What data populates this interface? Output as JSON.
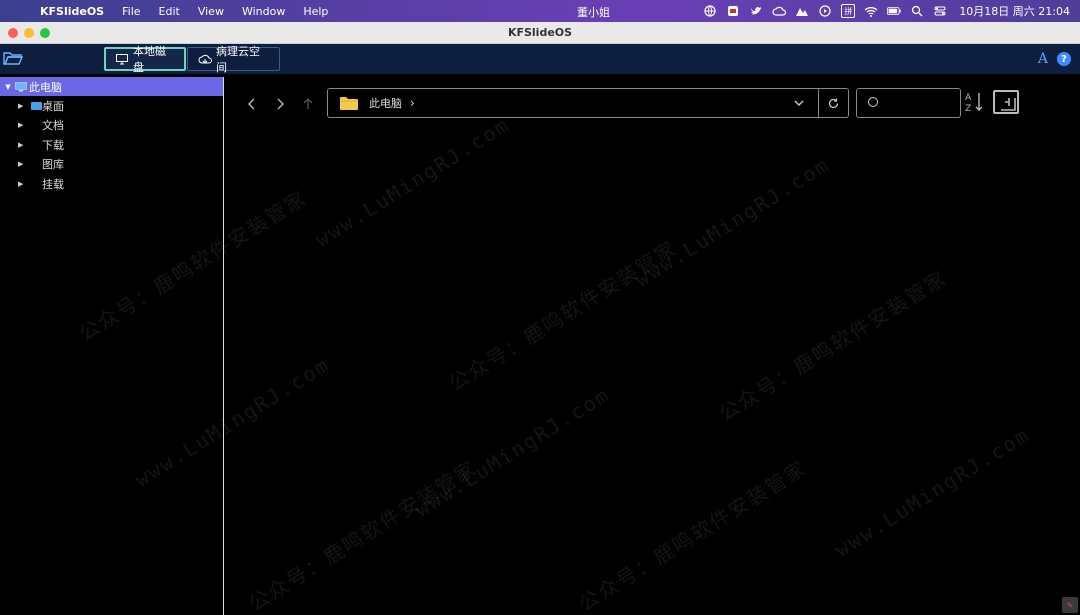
{
  "menubar": {
    "app_name": "KFSlideOS",
    "menus": [
      "File",
      "Edit",
      "View",
      "Window",
      "Help"
    ],
    "user_name": "董小姐",
    "input_method": "拼",
    "datetime": "10月18日 周六  21:04"
  },
  "window": {
    "title": "KFSlideOS"
  },
  "toolbar": {
    "tabs": [
      {
        "label": "本地磁盘",
        "icon": "monitor-icon",
        "active": true
      },
      {
        "label": "病理云空间",
        "icon": "cloud-icon",
        "active": false
      }
    ],
    "font_button": "A",
    "help_button": "?"
  },
  "sidebar": {
    "root": {
      "label": "此电脑",
      "icon": "computer-icon"
    },
    "items": [
      {
        "label": "桌面",
        "icon": "desktop-icon"
      },
      {
        "label": "文档"
      },
      {
        "label": "下载"
      },
      {
        "label": "图库"
      },
      {
        "label": "挂载"
      }
    ]
  },
  "address": {
    "path": "此电脑",
    "separator": "›"
  },
  "search": {
    "value": "",
    "placeholder": ""
  },
  "watermark": {
    "cn": "公众号：鹿鸣软件安装管家",
    "url": "www.LuMingRJ.com"
  },
  "colors": {
    "menubar_start": "#3b3f8f",
    "toolbar_bg": "#0d1e3f",
    "active_tab_border": "#6fd3c0",
    "tree_selected": "#6b67e6",
    "help_blue": "#3c8cff",
    "folder_yellow": "#f2c94c"
  }
}
